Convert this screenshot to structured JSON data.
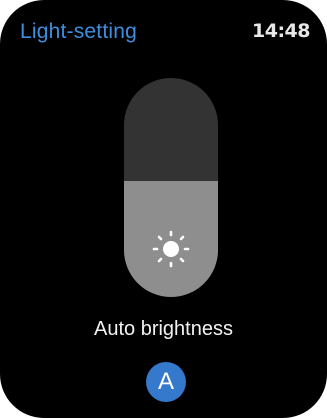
{
  "header": {
    "title": "Light-setting",
    "time": "14:48"
  },
  "brightness": {
    "level_fraction": 0.53,
    "icon": "sun-icon",
    "label": "Auto brightness"
  },
  "auto_button": {
    "label": "A"
  },
  "colors": {
    "accent": "#3d8fe0",
    "button": "#3579cc",
    "slider_track": "#333333",
    "slider_fill": "#8e8e8e"
  }
}
